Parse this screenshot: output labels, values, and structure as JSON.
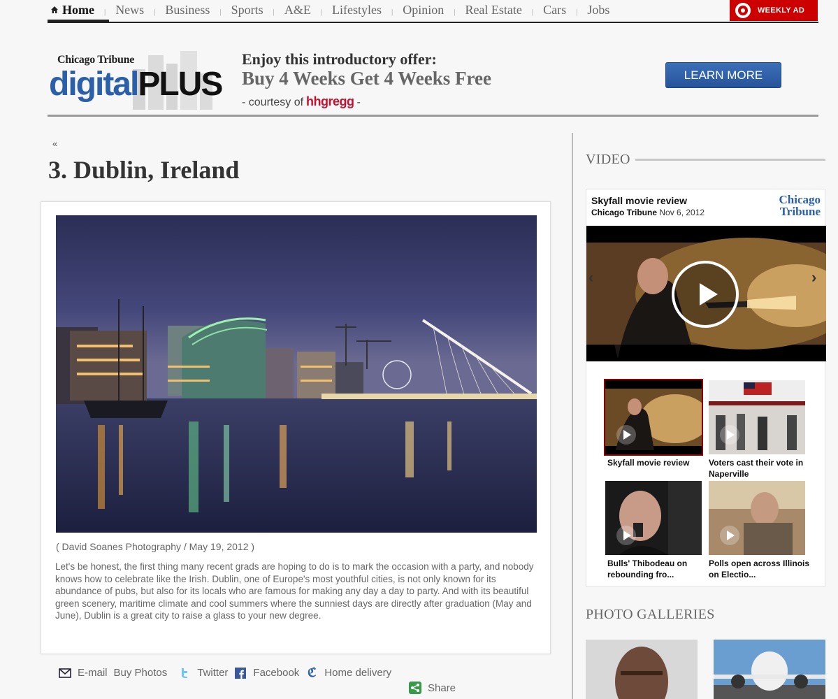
{
  "nav": {
    "items": [
      "Home",
      "News",
      "Business",
      "Sports",
      "A&E",
      "Lifestyles",
      "Opinion",
      "Real Estate",
      "Cars",
      "Jobs"
    ],
    "weekly_ad": "WEEKLY AD"
  },
  "promo": {
    "logo_small": "Chicago Tribune",
    "logo_digital": "digital",
    "logo_plus": "PLUS",
    "line1": "Enjoy this introductory offer:",
    "line2": "Buy 4 Weeks Get 4 Weeks Free",
    "courtesy": "- courtesy of",
    "sponsor": "hhgregg",
    "dash": "-",
    "button": "LEARN MORE"
  },
  "article": {
    "back": "«",
    "title": "3. Dublin, Ireland",
    "caption": "( David Soanes Photography / May 19, 2012 )",
    "body": "Let's be honest, the first thing many recent grads are hoping to do is to mark the occasion with a party, and nobody knows how to celebrate like the Irish. Dublin, one of Europe's most youthful cities, is not only known for its abundance of pubs, but also for its locals who are famous for making any day a day to party. And with its beautiful green scenery, maritime climate and cool summers where the sunniest days are directly after graduation (May and June), Dublin is a great city to raise a glass to your new degree."
  },
  "share": {
    "email": "E-mail",
    "buy_photos": "Buy Photos",
    "twitter": "Twitter",
    "facebook": "Facebook",
    "home_delivery": "Home delivery",
    "share": "Share"
  },
  "video": {
    "section_title": "VIDEO",
    "title": "Skyfall movie review",
    "source": "Chicago Tribune",
    "date": "Nov 6, 2012",
    "logo_line1": "Chicago",
    "logo_line2": "Tribune",
    "thumbs": [
      {
        "caption": "Skyfall movie review"
      },
      {
        "caption": "Voters cast their vote in Naperville"
      },
      {
        "caption": "Bulls' Thibodeau on rebounding fro..."
      },
      {
        "caption": "Polls open across Illinois on Electio..."
      }
    ]
  },
  "galleries": {
    "section_title": "PHOTO GALLERIES"
  },
  "colors": {
    "accent_blue": "#2b5fa8",
    "target_red": "#cc0000"
  }
}
